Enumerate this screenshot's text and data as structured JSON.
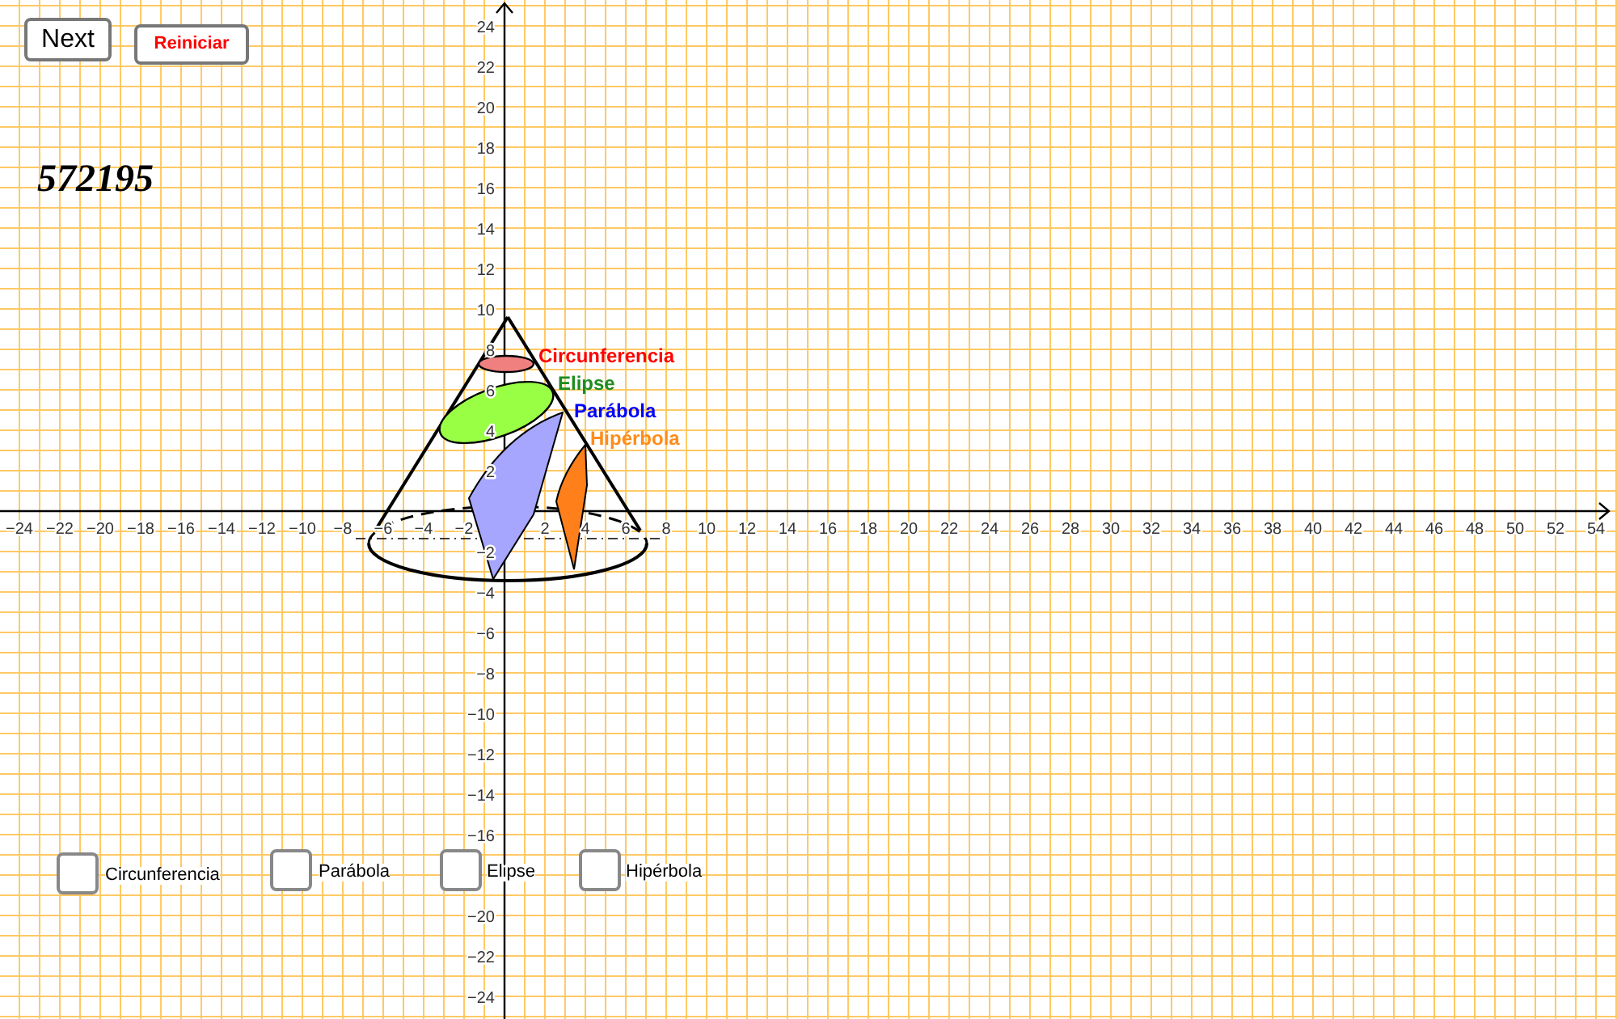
{
  "buttons": [
    {
      "label": "Next",
      "kind": "plain"
    },
    {
      "label": "Reiniciar",
      "kind": "alert"
    }
  ],
  "counter": "572195",
  "axes": {
    "x_ticks_negative": [
      "−24",
      "−22",
      "−20",
      "−18",
      "−16",
      "−14",
      "−12",
      "−10",
      "−8",
      "−6",
      "−4",
      "−2"
    ],
    "x_ticks_positive": [
      "2",
      "4",
      "6",
      "8",
      "10",
      "12",
      "14",
      "16",
      "18",
      "20",
      "22",
      "24",
      "26",
      "28",
      "30",
      "32",
      "34",
      "36",
      "38",
      "40",
      "42",
      "44",
      "46",
      "48",
      "50",
      "52",
      "54"
    ],
    "y_ticks_positive": [
      "24",
      "22",
      "20",
      "18",
      "16",
      "14",
      "12",
      "10",
      "8",
      "6",
      "4",
      "2"
    ],
    "y_ticks_negative_upper": [
      "−2",
      "−4",
      "−6",
      "−8",
      "−10",
      "−12",
      "−14",
      "−16"
    ],
    "y_ticks_negative_lower": [
      "−20",
      "−22",
      "−24"
    ]
  },
  "cone_labels": [
    {
      "text": "Circunferencia",
      "color": "#ff0000"
    },
    {
      "text": "Elipse",
      "color": "#1e8c1e"
    },
    {
      "text": "Parábola",
      "color": "#0000ff"
    },
    {
      "text": "Hipérbola",
      "color": "#ff8c1a"
    }
  ],
  "checkboxes": [
    {
      "label": "Circunferencia",
      "checked": false
    },
    {
      "label": "Parábola",
      "checked": false
    },
    {
      "label": "Elipse",
      "checked": false
    },
    {
      "label": "Hipérbola",
      "checked": false
    }
  ]
}
